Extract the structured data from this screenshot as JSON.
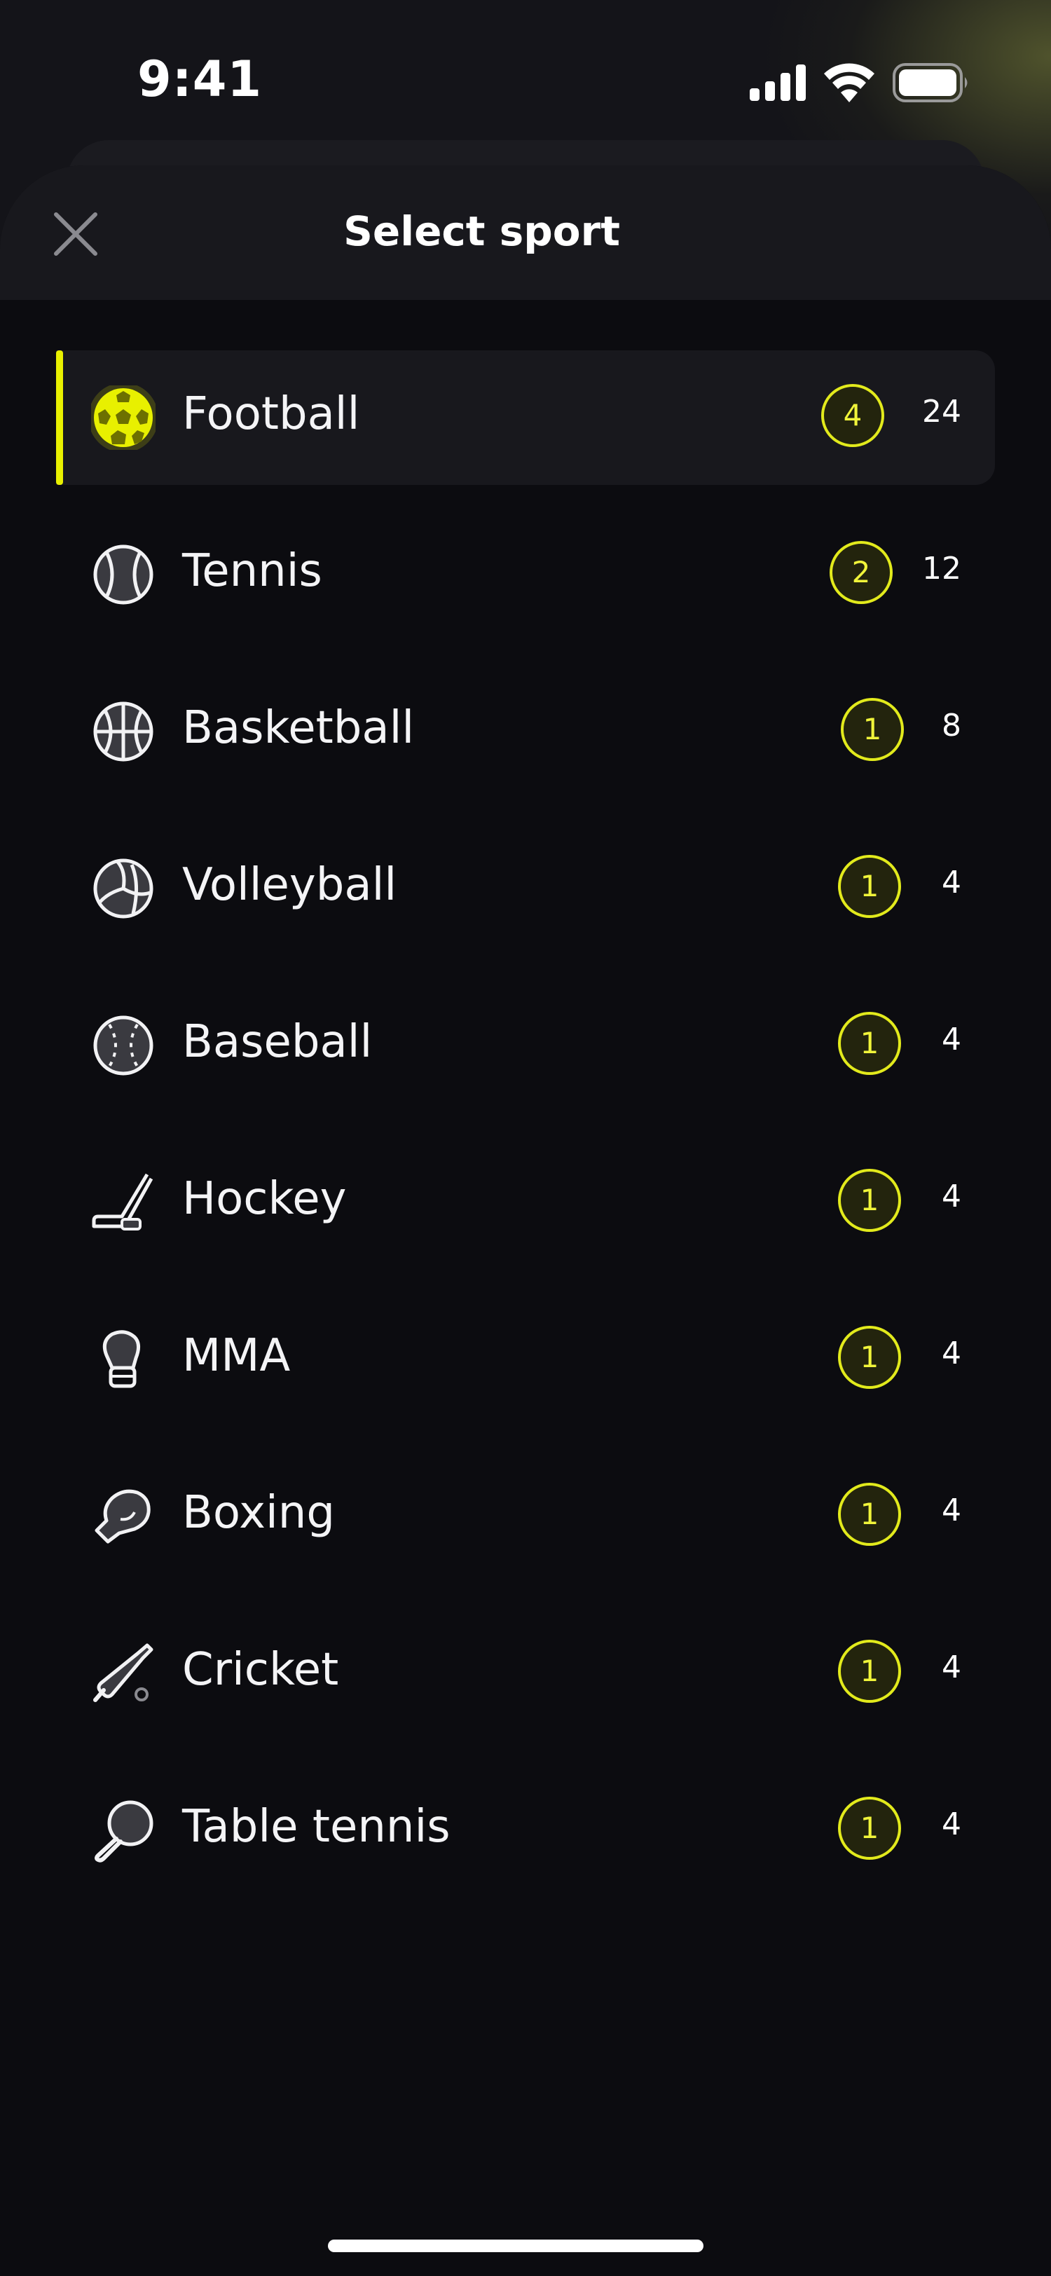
{
  "status_bar": {
    "time": "9:41"
  },
  "sheet": {
    "title": "Select sport",
    "close_icon": "close-icon"
  },
  "colors": {
    "accent": "#e8f000",
    "background": "#0c0c10",
    "header": "#18181d",
    "text": "#f2f2f4"
  },
  "sports": [
    {
      "name": "Football",
      "icon": "football-icon",
      "live": "4",
      "total": "24",
      "selected": true
    },
    {
      "name": "Tennis",
      "icon": "tennis-ball-icon",
      "live": "2",
      "total": "12",
      "selected": false
    },
    {
      "name": "Basketball",
      "icon": "basketball-icon",
      "live": "1",
      "total": "8",
      "selected": false
    },
    {
      "name": "Volleyball",
      "icon": "volleyball-icon",
      "live": "1",
      "total": "4",
      "selected": false
    },
    {
      "name": "Baseball",
      "icon": "baseball-icon",
      "live": "1",
      "total": "4",
      "selected": false
    },
    {
      "name": "Hockey",
      "icon": "hockey-stick-icon",
      "live": "1",
      "total": "4",
      "selected": false
    },
    {
      "name": "MMA",
      "icon": "mma-glove-icon",
      "live": "1",
      "total": "4",
      "selected": false
    },
    {
      "name": "Boxing",
      "icon": "boxing-glove-icon",
      "live": "1",
      "total": "4",
      "selected": false
    },
    {
      "name": "Cricket",
      "icon": "cricket-bat-icon",
      "live": "1",
      "total": "4",
      "selected": false
    },
    {
      "name": "Table tennis",
      "icon": "table-tennis-paddle-icon",
      "live": "1",
      "total": "4",
      "selected": false
    }
  ]
}
